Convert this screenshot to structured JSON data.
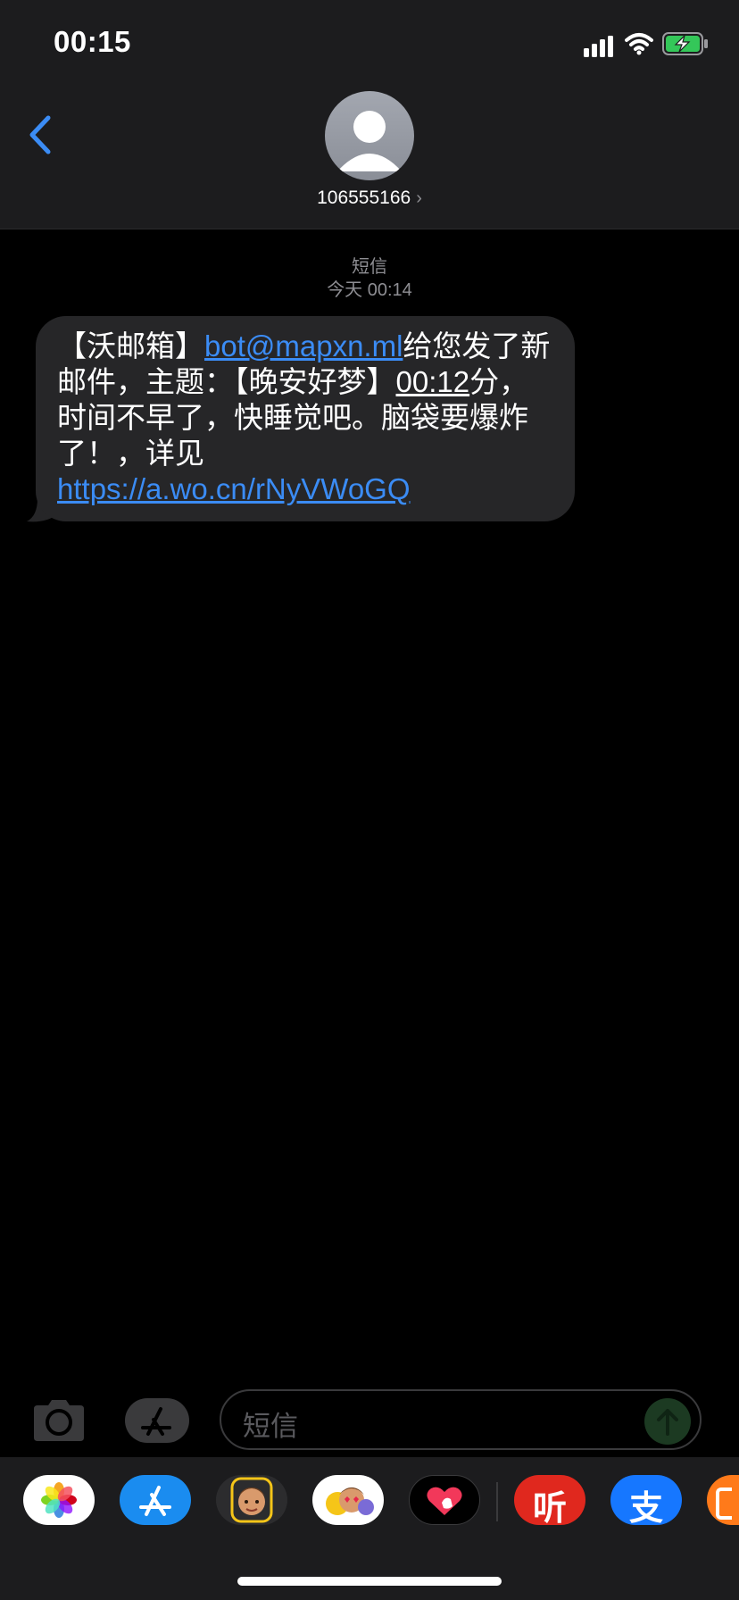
{
  "status_bar": {
    "time": "00:15"
  },
  "header": {
    "contact": "106555166"
  },
  "conversation": {
    "service_label": "短信",
    "timestamp": "今天 00:14",
    "message": {
      "seg1": "【沃邮箱】",
      "email_link": "bot@mapxn.ml",
      "seg2": "给您发了新邮件，主题：【晚安好梦】",
      "time_text": "00:12",
      "seg3": "分，时间不早了，快睡觉吧。脑袋要爆炸了！，详见 ",
      "url_link": "https://a.wo.cn/rNyVWoGQ"
    }
  },
  "input": {
    "placeholder": "短信"
  },
  "app_drawer": {
    "apps": [
      "photos-icon",
      "app-store-icon",
      "memoji-icon",
      "animoji-icon",
      "digital-touch-icon",
      "ting-icon",
      "alipay-icon",
      "partial-app-icon"
    ],
    "ting_char": "听",
    "alipay_char": "支"
  },
  "colors": {
    "link": "#3b8cf5",
    "bubble": "#262628",
    "accent_green": "#34c759"
  }
}
